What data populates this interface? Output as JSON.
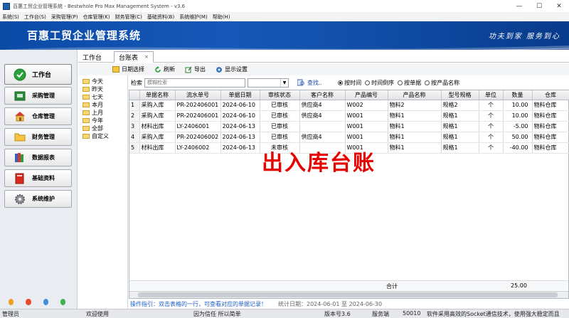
{
  "window": {
    "title": "百惠工贸企业管理系统 - Bestwhole Pro Max Management System - v3.6",
    "min": "—",
    "max": "☐",
    "close": "✕"
  },
  "menu": [
    "系统(S)",
    "工作台(S)",
    "采购管理(P)",
    "仓库管理(K)",
    "财务管理(C)",
    "基础资料(B)",
    "系统维护(M)",
    "帮助(H)"
  ],
  "banner": {
    "title": "百惠工贸企业管理系统",
    "slogan": "功夫到家 服务到心"
  },
  "nav": [
    {
      "label": "工作台",
      "icon": "check-icon"
    },
    {
      "label": "采购管理",
      "icon": "cart-icon"
    },
    {
      "label": "仓库管理",
      "icon": "house-icon"
    },
    {
      "label": "财务管理",
      "icon": "folder-icon"
    },
    {
      "label": "数据报表",
      "icon": "books-icon"
    },
    {
      "label": "基础资料",
      "icon": "book-icon"
    },
    {
      "label": "系统维护",
      "icon": "gear-icon"
    }
  ],
  "tabs": {
    "workbench": "工作台",
    "ledger": "台账表",
    "close": "×"
  },
  "toolbar": {
    "date_select": "日期选择",
    "refresh": "刷新",
    "export": "导出",
    "display_settings": "显示设置"
  },
  "tree": [
    "今天",
    "昨天",
    "七天",
    "本月",
    "上月",
    "今年",
    "全部",
    "自定义"
  ],
  "search": {
    "label": "检索",
    "placeholder": "模糊检索",
    "find": "查找..",
    "radios": [
      {
        "label": "按时间",
        "checked": true
      },
      {
        "label": "时间倒序",
        "checked": false
      },
      {
        "label": "按单据",
        "checked": false
      },
      {
        "label": "按产品名称",
        "checked": false
      }
    ]
  },
  "table": {
    "columns": [
      "",
      "单据名称",
      "流水单号",
      "单据日期",
      "审核状态",
      "客户名称",
      "产品编号",
      "产品名称",
      "型号规格",
      "单位",
      "数量",
      "仓库"
    ],
    "rows": [
      [
        "1",
        "采购入库",
        "PR-202406001",
        "2024-06-10",
        "已审核",
        "供应商4",
        "W002",
        "物料2",
        "规格2",
        "个",
        "10.00",
        "物料仓库"
      ],
      [
        "2",
        "采购入库",
        "PR-202406001",
        "2024-06-10",
        "已审核",
        "供应商4",
        "W001",
        "物料1",
        "规格1",
        "个",
        "10.00",
        "物料仓库"
      ],
      [
        "3",
        "材料出库",
        "LY-2406001",
        "2024-06-13",
        "已审核",
        "",
        "W001",
        "物料1",
        "规格1",
        "个",
        "-5.00",
        "物料仓库"
      ],
      [
        "4",
        "采购入库",
        "PR-202406002",
        "2024-06-13",
        "已审核",
        "供应商4",
        "W001",
        "物料1",
        "规格1",
        "个",
        "50.00",
        "物料仓库"
      ],
      [
        "5",
        "材料出库",
        "LY-2406002",
        "2024-06-13",
        "未审核",
        "",
        "W001",
        "物料1",
        "规格1",
        "个",
        "-40.00",
        "物料仓库"
      ]
    ],
    "total_label": "合计",
    "total_value": "25.00"
  },
  "overlay_text": "出入库台账",
  "hint": {
    "text": "操作指引：双击表格的一行，可查看对应的单据记录！",
    "stat": "统计日期：2024-06-01 至 2024-06-30"
  },
  "status": {
    "user": "管理员",
    "welcome": "欢迎使用",
    "motto": "因为信任 所以简单",
    "version": "版本号3.6",
    "server_label": "服务端",
    "port": "50010",
    "message": "软件采用高效的Socket通信技术，使用强大稳定而且"
  },
  "colors": {
    "banner": "#1658b8",
    "overlay": "#e60000",
    "hint": "#1f5fc8"
  }
}
